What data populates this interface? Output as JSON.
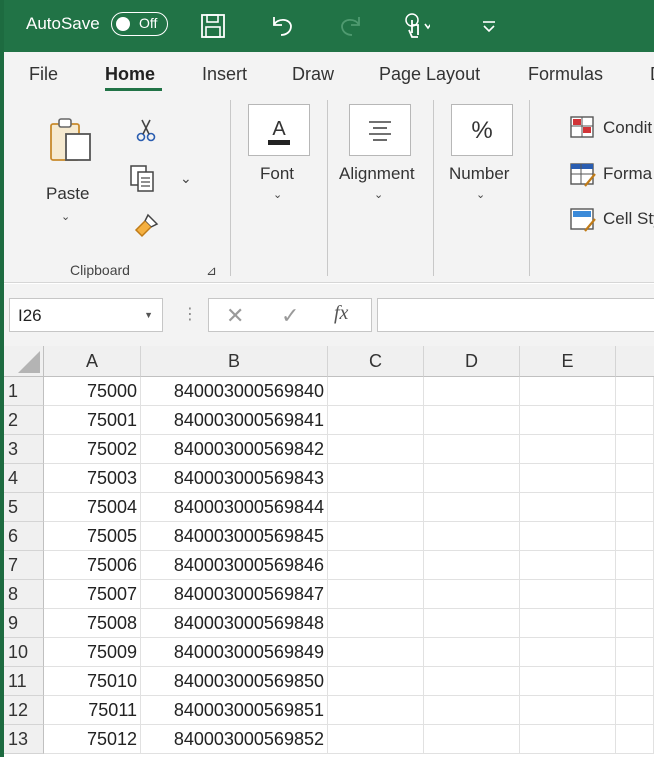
{
  "titlebar": {
    "autosave_label": "AutoSave",
    "toggle_state": "Off",
    "save_icon": "save-icon",
    "undo_icon": "undo-icon",
    "redo_icon": "redo-icon",
    "touch_mode_icon": "touch-mode-icon",
    "customize_icon": "customize-qat-icon",
    "accent_color": "#217346"
  },
  "tabs": [
    "File",
    "Home",
    "Insert",
    "Draw",
    "Page Layout",
    "Formulas",
    "D"
  ],
  "active_tab": "Home",
  "ribbon": {
    "clipboard": {
      "paste_label": "Paste",
      "group_label": "Clipboard"
    },
    "font_label": "Font",
    "alignment_label": "Alignment",
    "number_label": "Number",
    "styles": {
      "conditional": "Condit",
      "format_table": "Forma",
      "cell_styles": "Cell Sty"
    }
  },
  "formula_bar": {
    "name_box": "I26",
    "fx_label": "fx",
    "formula": ""
  },
  "sheet": {
    "columns": [
      "A",
      "B",
      "C",
      "D",
      "E"
    ],
    "rows": [
      {
        "row": "1",
        "a": "75000",
        "b": "840003000569840"
      },
      {
        "row": "2",
        "a": "75001",
        "b": "840003000569841"
      },
      {
        "row": "3",
        "a": "75002",
        "b": "840003000569842"
      },
      {
        "row": "4",
        "a": "75003",
        "b": "840003000569843"
      },
      {
        "row": "5",
        "a": "75004",
        "b": "840003000569844"
      },
      {
        "row": "6",
        "a": "75005",
        "b": "840003000569845"
      },
      {
        "row": "7",
        "a": "75006",
        "b": "840003000569846"
      },
      {
        "row": "8",
        "a": "75007",
        "b": "840003000569847"
      },
      {
        "row": "9",
        "a": "75008",
        "b": "840003000569848"
      },
      {
        "row": "10",
        "a": "75009",
        "b": "840003000569849"
      },
      {
        "row": "11",
        "a": "75010",
        "b": "840003000569850"
      },
      {
        "row": "12",
        "a": "75011",
        "b": "840003000569851"
      },
      {
        "row": "13",
        "a": "75012",
        "b": "840003000569852"
      }
    ]
  }
}
